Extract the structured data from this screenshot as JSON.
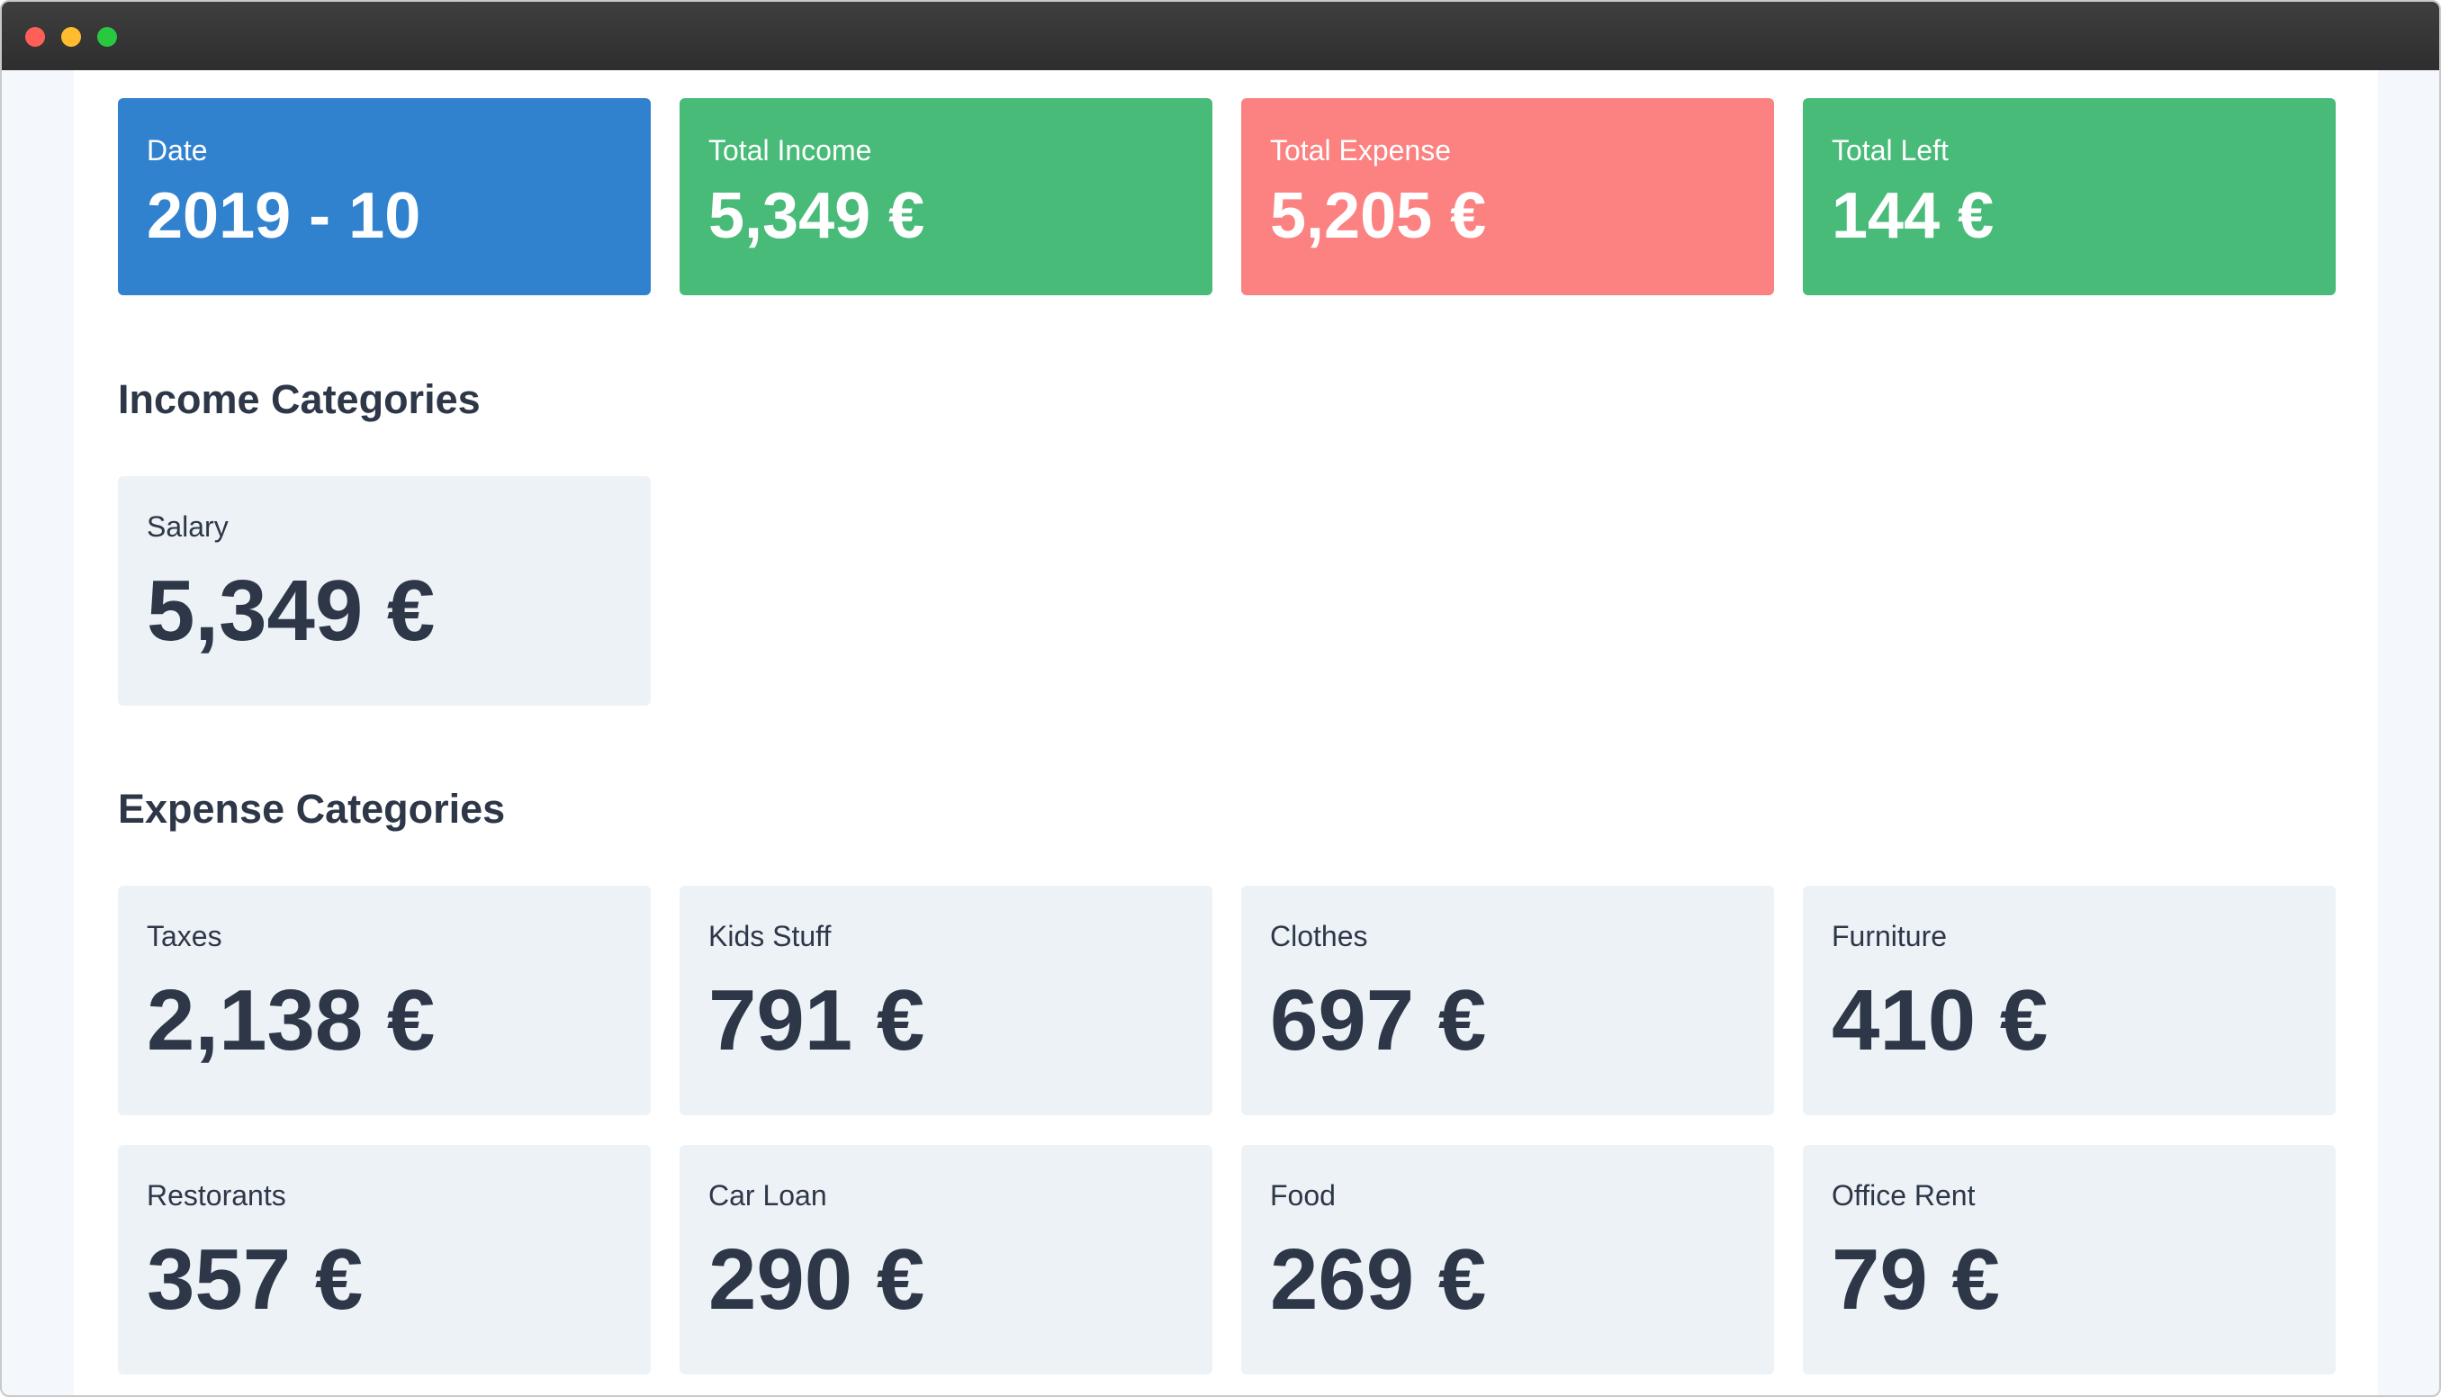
{
  "summary": {
    "date": {
      "label": "Date",
      "value": "2019 - 10"
    },
    "income": {
      "label": "Total Income",
      "value": "5,349 €"
    },
    "expense": {
      "label": "Total Expense",
      "value": "5,205 €"
    },
    "left": {
      "label": "Total Left",
      "value": "144 €"
    }
  },
  "income_section": {
    "title": "Income Categories",
    "items": [
      {
        "label": "Salary",
        "value": "5,349 €"
      }
    ]
  },
  "expense_section": {
    "title": "Expense Categories",
    "items": [
      {
        "label": "Taxes",
        "value": "2,138 €"
      },
      {
        "label": "Kids Stuff",
        "value": "791 €"
      },
      {
        "label": "Clothes",
        "value": "697 €"
      },
      {
        "label": "Furniture",
        "value": "410 €"
      },
      {
        "label": "Restorants",
        "value": "357 €"
      },
      {
        "label": "Car Loan",
        "value": "290 €"
      },
      {
        "label": "Food",
        "value": "269 €"
      },
      {
        "label": "Office Rent",
        "value": "79 €"
      }
    ]
  },
  "colors": {
    "date_card": "#3182ce",
    "income_card": "#48bb78",
    "expense_card": "#fc8181",
    "left_card": "#48bb78",
    "category_card": "#edf2f7",
    "text_dark": "#2d3748"
  }
}
